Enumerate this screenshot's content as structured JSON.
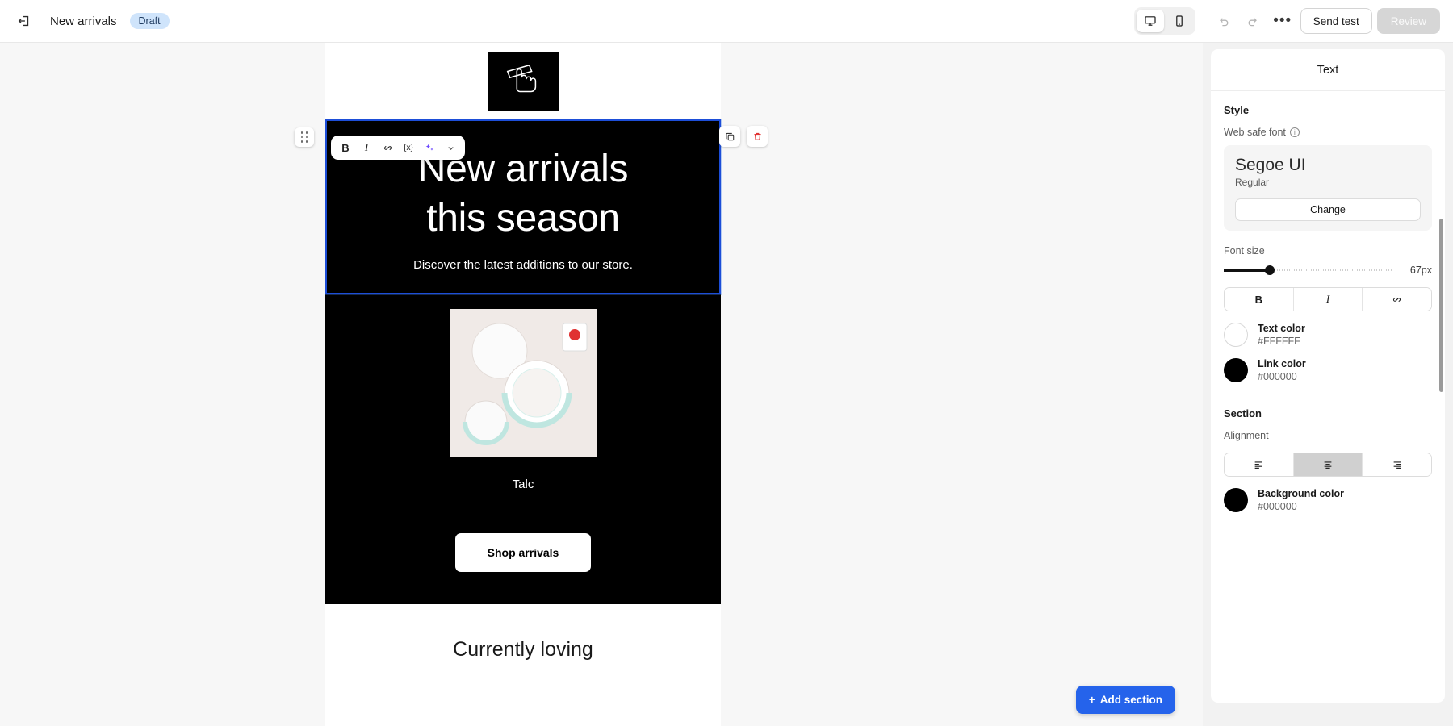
{
  "topbar": {
    "exit_icon": "exit-icon",
    "title": "New arrivals",
    "status_badge": "Draft",
    "device_desktop_icon": "desktop-icon",
    "device_mobile_icon": "mobile-icon",
    "undo_icon": "undo-icon",
    "redo_icon": "redo-icon",
    "more_label": "•••",
    "send_test_label": "Send test",
    "review_label": "Review"
  },
  "format_toolbar": {
    "bold_label": "B",
    "italic_label": "I",
    "link_icon": "link-icon",
    "merge_tag_label": "{x}",
    "ai_icon": "ai-sparkle-icon",
    "chevron_icon": "chevron-down-icon"
  },
  "canvas": {
    "drag_handle_icon": "drag-handle-icon",
    "duplicate_icon": "duplicate-icon",
    "delete_icon": "delete-icon",
    "hero_logo_icon": "hand-pointer-logo-icon",
    "heading_line1": "New arrivals",
    "heading_line2": "this season",
    "subheading": "Discover the latest additions to our store.",
    "product_caption": "Talc",
    "cta_label": "Shop arrivals",
    "next_section_title": "Currently loving",
    "add_section_label": "Add section",
    "add_section_icon": "plus-icon"
  },
  "panel": {
    "header": "Text",
    "style": {
      "section_title": "Style",
      "font_label": "Web safe font",
      "info_icon": "info-icon",
      "font_name": "Segoe UI",
      "font_weight": "Regular",
      "change_label": "Change",
      "font_size_label": "Font size",
      "font_size_value": "67px",
      "bold_label": "B",
      "italic_label": "I",
      "link_icon": "link-icon",
      "text_color_label": "Text color",
      "text_color_hex": "#FFFFFF",
      "link_color_label": "Link color",
      "link_color_hex": "#000000"
    },
    "section": {
      "section_title": "Section",
      "alignment_label": "Alignment",
      "align_left_icon": "align-left-icon",
      "align_center_icon": "align-center-icon",
      "align_right_icon": "align-right-icon",
      "background_color_label": "Background color",
      "background_color_hex": "#000000"
    }
  }
}
